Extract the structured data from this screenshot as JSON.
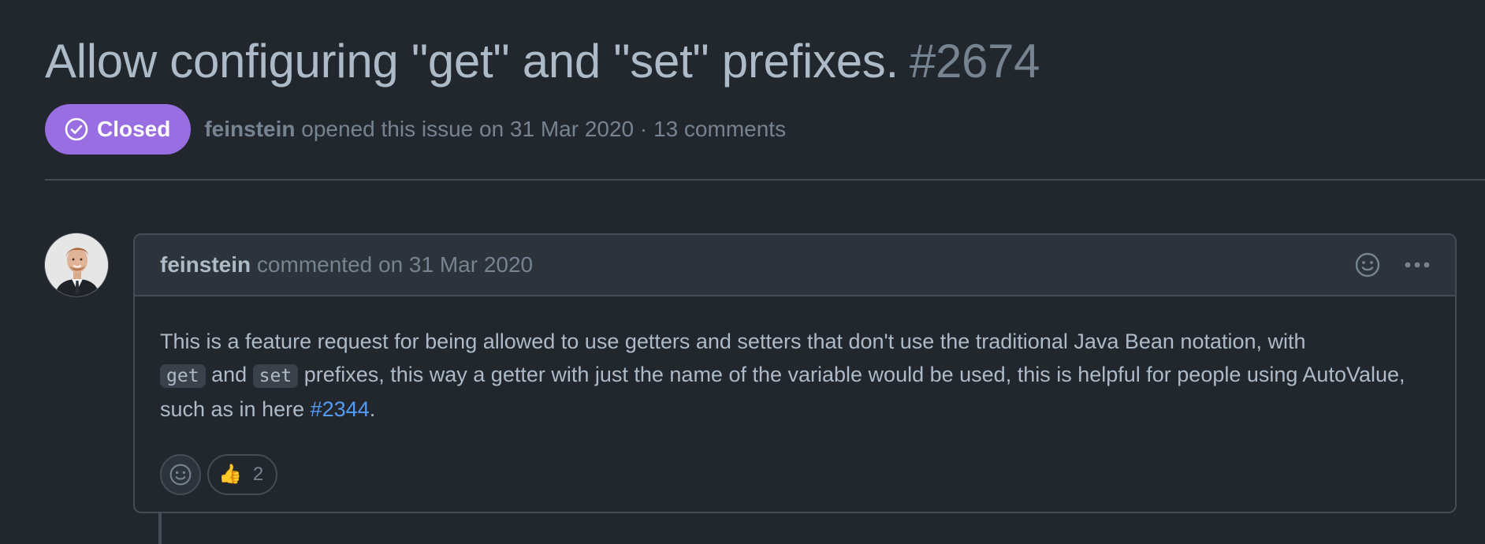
{
  "issue": {
    "title": "Allow configuring \"get\" and \"set\" prefixes.",
    "number": "#2674",
    "state": "Closed",
    "author": "feinstein",
    "meta": "opened this issue on 31 Mar 2020 · 13 comments"
  },
  "comment": {
    "author": "feinstein",
    "action": "commented on 31 Mar 2020",
    "body": {
      "part1": "This is a feature request for being allowed to use getters and setters that don't use the traditional Java Bean notation, with",
      "code1": "get",
      "and": "and",
      "code2": "set",
      "part2": "prefixes, this way a getter with just the name of the variable would be used, this is helpful for people using AutoValue, such as in here",
      "link": "#2344",
      "end": "."
    },
    "reactions": [
      {
        "emoji": "👍",
        "count": "2"
      }
    ]
  },
  "icons": {
    "state": "check-circle-icon",
    "reaction_header": "smiley-icon",
    "menu": "kebab-horizontal-icon",
    "reaction_add": "smiley-icon"
  },
  "colors": {
    "background": "#22272e",
    "header_bg": "#2d333b",
    "border": "#444c56",
    "text": "#adbac7",
    "muted": "#768390",
    "closed_badge": "#986ee2",
    "link": "#539bf5"
  }
}
